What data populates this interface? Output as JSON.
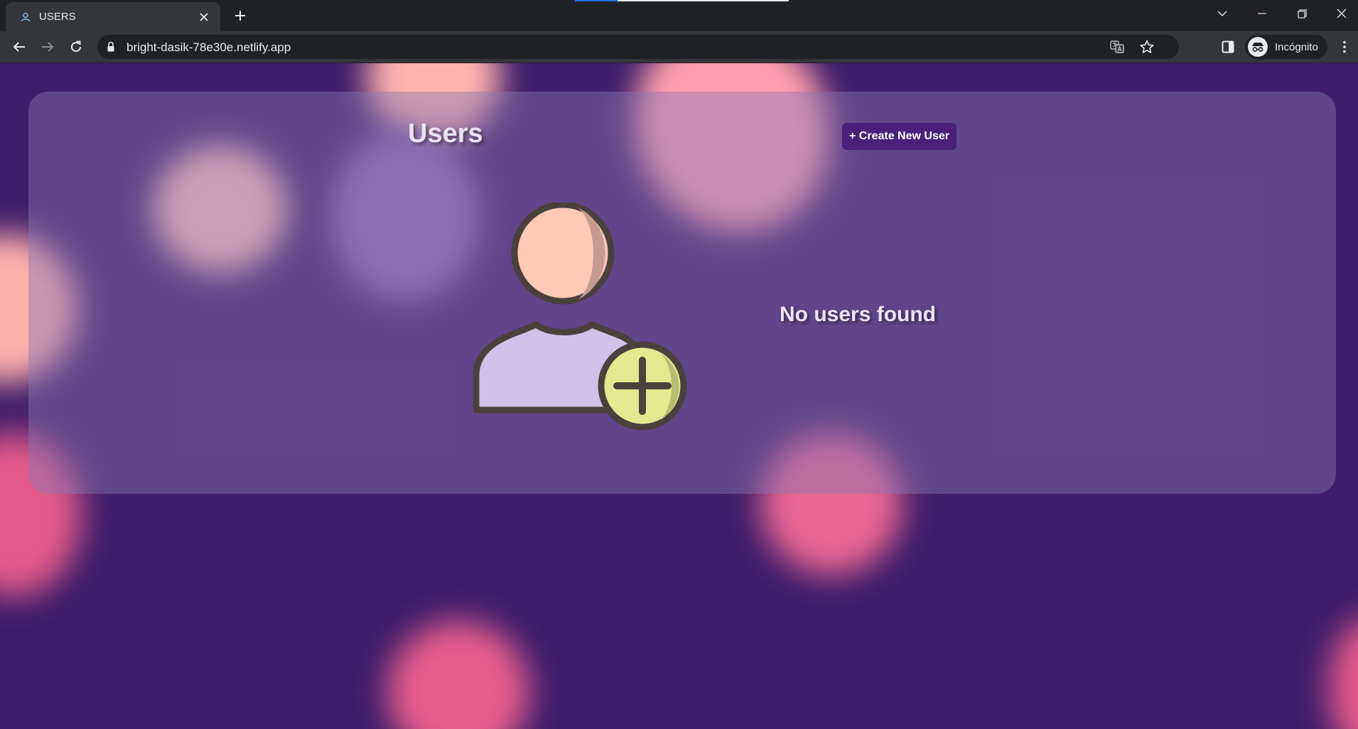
{
  "browser": {
    "tab": {
      "title": "USERS",
      "favicon": "user-icon"
    },
    "url": "bright-dasik-78e30e.netlify.app",
    "profile_label": "Incógnito"
  },
  "page": {
    "title": "Users",
    "create_button_label": "+ Create New User",
    "empty_message": "No users found",
    "illustration": "add-user-icon"
  },
  "colors": {
    "background": "#3f1d6b",
    "button": "#4b1f7a",
    "blob_pink": "#f06a96",
    "blob_peach": "#ffb8b0"
  }
}
